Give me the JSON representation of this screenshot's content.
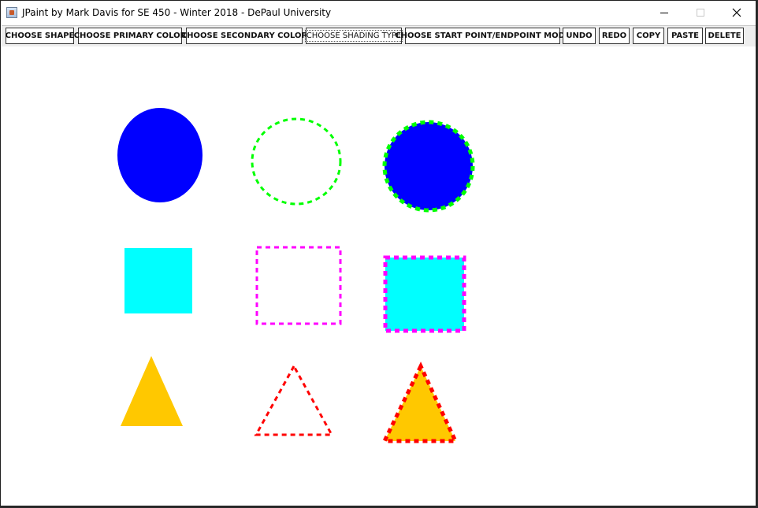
{
  "window": {
    "title": "JPaint by Mark Davis for SE 450 - Winter 2018 - DePaul University"
  },
  "toolbar": {
    "buttons": [
      {
        "label": "CHOOSE SHAPE"
      },
      {
        "label": "CHOOSE PRIMARY COLOR"
      },
      {
        "label": "CHOOSE SECONDARY COLOR"
      },
      {
        "label": "CHOOSE SHADING TYPE"
      },
      {
        "label": "CHOOSE START POINT/ENDPOINT MODE"
      },
      {
        "label": "UNDO"
      },
      {
        "label": "REDO"
      },
      {
        "label": "COPY"
      },
      {
        "label": "PASTE"
      },
      {
        "label": "DELETE"
      }
    ]
  },
  "colors": {
    "blue": "#0000ff",
    "green": "#00ff00",
    "cyan": "#00ffff",
    "magenta": "#ff00ff",
    "yellow": "#ffc800",
    "red": "#ff0000"
  },
  "icons": {
    "minimize": "minimize-icon",
    "maximize": "maximize-icon",
    "close": "close-icon"
  }
}
